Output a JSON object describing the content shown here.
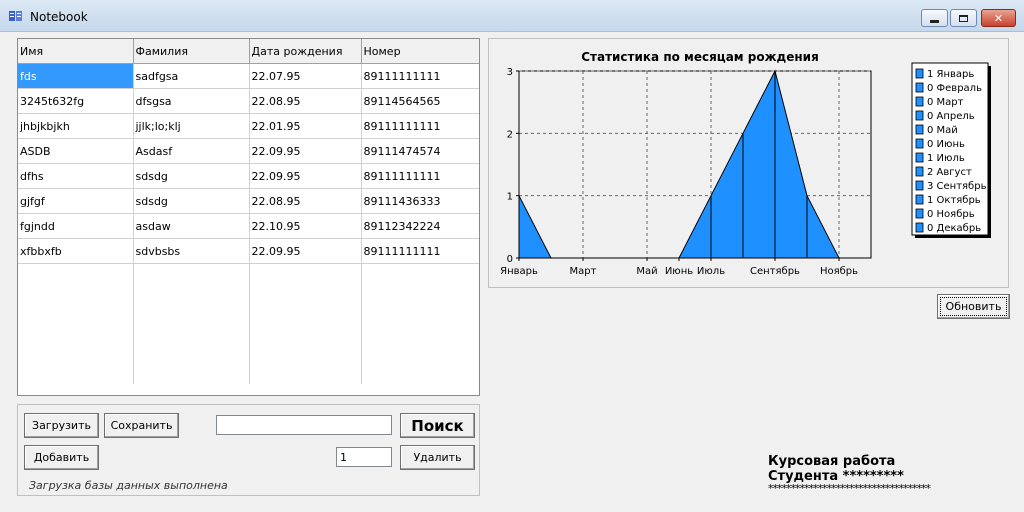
{
  "window": {
    "title": "Notebook"
  },
  "grid": {
    "columns": [
      "Имя",
      "Фамилия",
      "Дата рождения",
      "Номер"
    ],
    "rows": [
      [
        "fds",
        "sadfgsa",
        "22.07.95",
        "89111111111"
      ],
      [
        "3245t632fg",
        "dfsgsa",
        "22.08.95",
        "89114564565"
      ],
      [
        "jhbjkbjkh",
        "jjlk;lo;klj",
        "22.01.95",
        "89111111111"
      ],
      [
        "ASDB",
        "Asdasf",
        "22.09.95",
        "89111474574"
      ],
      [
        "dfhs",
        "sdsdg",
        "22.09.95",
        "89111111111"
      ],
      [
        "gjfgf",
        "sdsdg",
        "22.08.95",
        "89111436333"
      ],
      [
        "fgjndd",
        "asdaw",
        "22.10.95",
        "89112342224"
      ],
      [
        "xfbbxfb",
        "sdvbsbs",
        "22.09.95",
        "89111111111"
      ]
    ]
  },
  "controls": {
    "load": "Загрузить",
    "save": "Сохранить",
    "search": "Поиск",
    "add": "Добавить",
    "delete": "Удалить",
    "delete_index": "1",
    "search_value": "",
    "refresh": "Обновить",
    "status": "Загрузка базы данных выполнена"
  },
  "footer": {
    "line1": "Курсовая работа",
    "line2": "Студента *********",
    "stars": "************************************"
  },
  "chart_data": {
    "type": "area",
    "title": "Статистика по месяцам рождения",
    "categories": [
      "Январь",
      "Февраль",
      "Март",
      "Апрель",
      "Май",
      "Июнь",
      "Июль",
      "Август",
      "Сентябрь",
      "Октябрь",
      "Ноябрь",
      "Декабрь"
    ],
    "values": [
      1,
      0,
      0,
      0,
      0,
      0,
      1,
      2,
      3,
      1,
      0,
      0
    ],
    "x_tick_labels": [
      "Январь",
      "Март",
      "Май",
      "Июнь",
      "Июль",
      "Сентябрь",
      "Ноябрь"
    ],
    "y_ticks": [
      "0",
      "1",
      "2",
      "3"
    ],
    "ylim": [
      0,
      3
    ],
    "grid": true,
    "legend_position": "right",
    "legend": [
      "1 Январь",
      "0 Февраль",
      "0 Март",
      "0 Апрель",
      "0 Май",
      "0 Июнь",
      "1 Июль",
      "2 Август",
      "3 Сентябрь",
      "1 Октябрь",
      "0 Ноябрь",
      "0 Декабрь"
    ],
    "color": "#1e90ff"
  }
}
